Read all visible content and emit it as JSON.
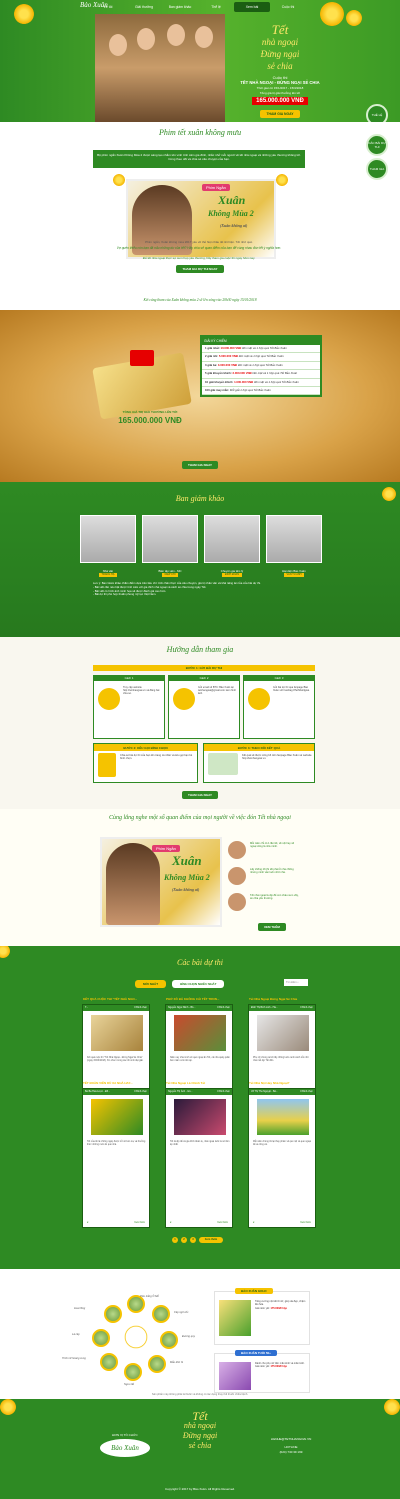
{
  "header": {
    "logo": "Bảo Xuân",
    "nav": [
      "Về tôi",
      "Giải thưởng",
      "Ban giám khảo",
      "Thể lệ",
      "Xem bài",
      "Cuộc thi"
    ],
    "active_nav": "Xem bài"
  },
  "hero": {
    "slogan_line1": "Tết",
    "slogan_line2": "nhà ngoại",
    "slogan_line3": "Đừng ngại",
    "slogan_line4": "sẻ chia",
    "contest_label": "Cuộc thi",
    "contest_name": "TẾT NHÀ NGOẠI - ĐỪNG NGẠI SẺ CHIA",
    "period": "Thời gian từ 15/1/2017 - 15/3/2018",
    "prize_note": "Tổng giá trị giải thưởng lên tới",
    "prize_value": "165.000.000 VNĐ",
    "cta": "THAM GIA NGAY",
    "side_buttons": [
      "THỂ LỆ",
      "CÁC BÀI DỰ THI",
      "THAM GIA"
    ]
  },
  "film": {
    "title": "Phim tết xuân không mưu",
    "intro": "Bộ phim ngắn Xuân Không Mùa 2 được sáng tạo nhằm tôn vinh tình cảm gia đình, nhắc nhở mỗi người về tết nhà ngoại và những yêu thương không lời. Cùng theo dõi và chia sẻ câu chuyện của bạn.",
    "badge": "Phim Ngắn",
    "poster_title_1": "Xuân",
    "poster_title_2": "Không Mùa 2",
    "poster_sub": "(Xuân không ai)",
    "caption": "Phim ngắn, Xuân không mùa 2017 yêu về thể hiện thâu tết tết hiện. Tết nhớ quê.",
    "question": "Vợ quên thiếu còn bạn đã nấu những dư của tết? Hãy chia sẻ quan điểm của bạn để cùng nhau đón tết ý nghĩa hơn.",
    "note": "Để tết nhà ngoại thực sự sum họp yêu thương, hãy tham gia cuộc thi ngay hôm nay.",
    "cta": "THAM GIA DỰ THI NGAY",
    "deadline": "Kết cúng tham của Xuân không mùa 2 sẽ lên sóng vào 20h30 ngày 15/01/2018"
  },
  "prize": {
    "tagline": "TỔNG GIÁ TRỊ GIẢI THƯỞNG LÊN TỚI",
    "value": "165.000.000 VNĐ",
    "table_title": "GIẢI KỲ CHIẾM",
    "rows": [
      {
        "label": "1 giải nhất:",
        "value": "10.000.000 VNĐ",
        "desc": "tiền mặt và 1 hộp quà Tết Bảo Xuân"
      },
      {
        "label": "2 giải nhì:",
        "value": "5.000.000 VNĐ",
        "desc": "tiền mặt và 1 hộp quà Tết Bảo Xuân"
      },
      {
        "label": "3 giải ba:",
        "value": "3.000.000 VNĐ",
        "desc": "tiền mặt và 1 hộp quà Tết Bảo Xuân"
      },
      {
        "label": "5 giải khuyến khích:",
        "value": "2.000.000 VNĐ",
        "desc": "tiền mặt và 1 hộp quà Tết Bảo Xuân"
      },
      {
        "label": "10 giải khuyến khích:",
        "value": "1.000.000 VNĐ",
        "desc": "tiền mặt và 1 hộp quà Tết Bảo Xuân"
      },
      {
        "label": "100 giải may mắn:",
        "value": "",
        "desc": "Mỗi giải 1 hộp quà Tết Bảo Xuân"
      }
    ],
    "cta": "THAM GIA NGAY"
  },
  "judges": {
    "title": "Ban giám khảo",
    "list": [
      {
        "role": "Nhà văn",
        "name": "TRANG HẠ"
      },
      {
        "role": "Biên tập viên - MC",
        "name": "DIỆP CHI"
      },
      {
        "role": "Chuyên gia tâm lý",
        "name": "ĐINH ĐOAN"
      },
      {
        "role": "Đại diện Bảo Xuân",
        "name": "VĂN TÚ ANH"
      }
    ],
    "text": [
      "Lưu ý: Ban Giám khảo chấm điểm dựa trên tiêu chí: tính chân thực của câu chuyện, giá trị nhân văn và khả năng lan tỏa của bài dự thi.",
      "- Bài viết cần nêu bật được tình cảm với gia đình nhà ngoại và cách sẻ chia trong ngày Tết.",
      "- Bài viết có hình ảnh minh họa sẽ được đánh giá cao hơn.",
      "- Bài dự thi phù hợp thuần phong mỹ tục Việt Nam."
    ]
  },
  "guide": {
    "title": "Hướng dẫn tham gia",
    "step1": "BƯỚC 1: GỬI BÀI DỰ THI",
    "cards": [
      {
        "head": "Cách 1",
        "text": "Truy cập website http://tetnhangoai.vn và đăng bài chia sẻ."
      },
      {
        "head": "Cách 2",
        "text": "Gửi email về BTC: Bảo Xuân tại tetnhangoai@gmail.com kèm hình ảnh."
      },
      {
        "head": "Cách 3",
        "text": "Gửi bài dự thi qua fanpage Bảo Xuân với hashtag #TetNhaNgoai."
      }
    ],
    "step2": "BƯỚC 2: KÊU GỌI BÌNH CHỌN",
    "step2_text": "Chia sẻ bài dự thi của bạn lên trang cá nhân và kêu gọi bạn bè bình chọn.",
    "step3": "BƯỚC 3: THEO DÕI KẾT QUẢ",
    "step3_text": "Kết quả sẽ được công bố trên fanpage Bảo Xuân và website http://tetnhangoai.vn.",
    "cta": "THAM GIA NGAY"
  },
  "community": {
    "title": "Cùng lắng nghe một số quan điểm của mọi người về việc đón Tết nhà ngoại",
    "badge": "Phim Ngắn",
    "poster_title_1": "Xuân",
    "poster_title_2": "Không Mùa 2",
    "poster_sub": "(Xuân không ai)",
    "comments": [
      "Mỗi năm chỉ có 1 lần tết, về nội hay về ngoại cũng là nhà mình.",
      "Lấy chồng rồi thì tết phải ở nhà chồng nhưng mình vẫn luôn nhớ nhà.",
      "Tết nhà ngoại là dịp để con cháu sum vầy, sẻ chia yêu thương."
    ],
    "cta": "XEM THÊM"
  },
  "contest": {
    "title": "Các bài dự thi",
    "tabs": [
      "MỚI NHẤT",
      "BÌNH CHỌN NHIỀU NHẤT"
    ],
    "search_placeholder": "Tìm kiếm",
    "entries": [
      {
        "title": "KẾT QUẢ CUỘC THI \"TẾT NHÀ NGO...",
        "author": "T...",
        "score": "0 Bình chọn",
        "text": "Kết quả cuộc thi \"Tết Nhà Ngoại - Đừng Ngại Sẻ Chia\" (ngày 15/03/2018). Xin chúc mừng các thí sinh đạt giải.",
        "more": "Xem thêm"
      },
      {
        "title": "PHỞ XÔ BÁ KHÔNG CÁI TẾT TRON...",
        "author": "Nguyễn Ngọc Minh - Bó...",
        "score": "0 Bình chọn",
        "text": "Năm nay nhà mình về quê ngoại ăn Tết, cả nhà quây quần bên mâm cơm ấm áp.",
        "more": "Xem thêm"
      },
      {
        "title": "Tết Nhà Ngoại Đừng Ngại Sẻ Chia",
        "author": "Đinh Thị Bích Linh - Hà...",
        "score": "0 Bình chọn",
        "text": "Phụ nữ chúng ta khi lấy chồng luôn canh cánh nỗi nhớ nhà mỗi dịp Tết đến.",
        "more": "Xem thêm"
      },
      {
        "title": "TẾT ĐOÀN VIÊN DÙ XA NHÀ HAY...",
        "author": "Bé Ba Hoà Lược - Đồ...",
        "score": "0 Bình chọn",
        "text": "Tết của tôi là những ngày được trở về bên mẹ và thưởng thức những món ăn quê nhà.",
        "more": "Xem thêm"
      },
      {
        "title": "Tết Nhà Ngoại Là Chính Tết",
        "author": "Nguyễn Thị Ảnh - Gò...",
        "score": "0 Bình chọn",
        "text": "Tết là dịp để cả gia đình đoàn tụ, nhà ngoại luôn là nơi ấm áp nhất.",
        "more": "Xem thêm"
      },
      {
        "title": "Tết Nhà Nội Hay Nhà Ngoại?",
        "author": "Võ Thị Thu Nguyệt - Bê...",
        "score": "0 Bình chọn",
        "text": "Mỗi năm chúng tôi lại thay phiên về quê nội và quê ngoại để ai cũng vui.",
        "more": "Xem thêm"
      }
    ],
    "pages": [
      "1",
      "2",
      "3"
    ],
    "next": "Xem thêm"
  },
  "product": {
    "herbs": [
      "Tiêu trắng Ô Mễ",
      "Cây ngũ cốc",
      "Đương quy",
      "Mẫu đơn bì",
      "Ngưu tất",
      "Trinh nữ hoàng cung",
      "Lá cây",
      "Hoa hồng"
    ],
    "boxes": [
      {
        "name": "BẢO XUÂN GOLD",
        "text": "Tăng cường nội tiết tố nữ, giúp da đẹp, chậm lão hóa.",
        "price_label": "Giá niêm yết:",
        "price": "175.000đ/ hộp"
      },
      {
        "name": "BẢO XUÂN TUỔI 50+",
        "text": "Dành cho phụ nữ tiền mãn kinh và mãn kinh.",
        "price_label": "Giá niêm yết:",
        "price": "175.000đ/ hộp"
      }
    ],
    "note": "Sản phẩm này không phải là thuốc và không có tác dụng thay thế thuốc chữa bệnh."
  },
  "footer": {
    "organizer_label": "ĐƠN VỊ TỔ CHỨC",
    "brand": "Bảo Xuân",
    "slogan_1": "Tết",
    "slogan_2": "nhà ngoại",
    "slogan_3": "Đừng ngại",
    "slogan_4": "sẻ chia",
    "email": "LIENHE@TETNHANGOAI.VN",
    "hotline_label": "HOTLINE",
    "hotline": "(024) 730 39 199",
    "copyright": "Copyright © 2017 by Bảo Xuân. All Rights Reserved."
  }
}
